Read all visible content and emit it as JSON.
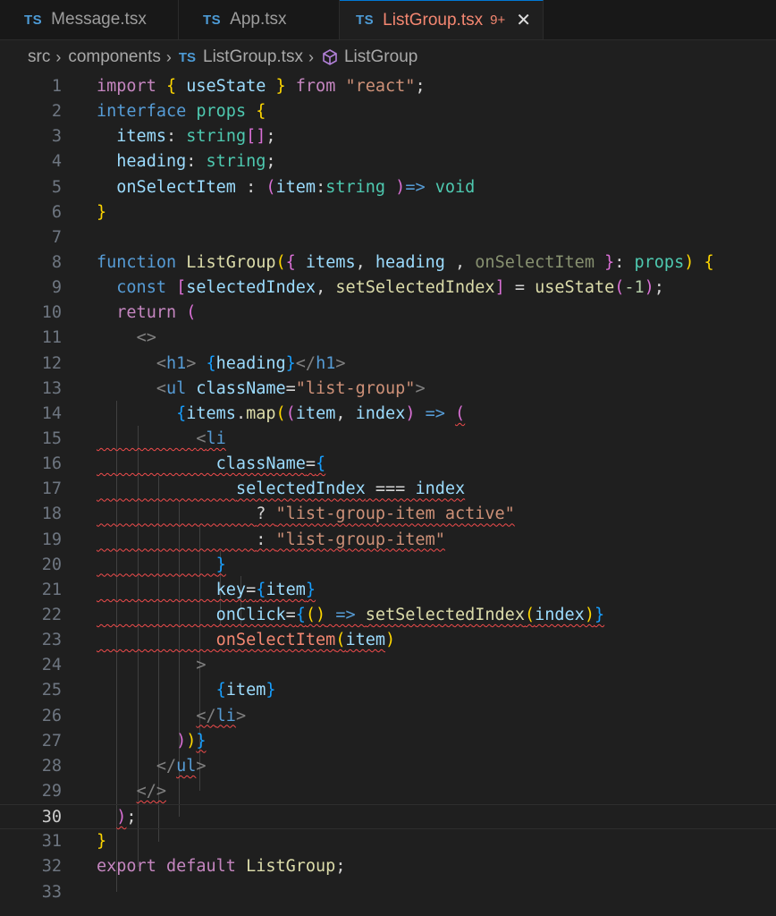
{
  "tabs": [
    {
      "lang": "TS",
      "label": "Message.tsx"
    },
    {
      "lang": "TS",
      "label": "App.tsx"
    },
    {
      "lang": "TS",
      "label": "ListGroup.tsx",
      "badge": "9+",
      "close": "✕"
    }
  ],
  "breadcrumb": {
    "src": "src",
    "components": "components",
    "file": "ListGroup.tsx",
    "symbol": "ListGroup",
    "lang": "TS"
  },
  "line_numbers": [
    "1",
    "2",
    "3",
    "4",
    "5",
    "6",
    "7",
    "8",
    "9",
    "10",
    "11",
    "12",
    "13",
    "14",
    "15",
    "16",
    "17",
    "18",
    "19",
    "20",
    "21",
    "22",
    "23",
    "24",
    "25",
    "26",
    "27",
    "28",
    "29",
    "30",
    "31",
    "32",
    "33"
  ],
  "colors": {
    "accent": "#0078d4",
    "error": "#f14c4c",
    "tab_active_text": "#f48771"
  }
}
